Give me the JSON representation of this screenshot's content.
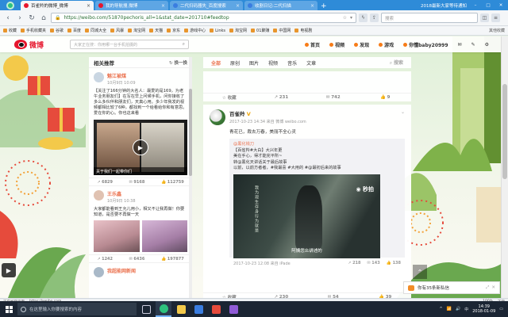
{
  "browser": {
    "tabs": [
      {
        "label": "百雀羚的微博_微博",
        "active": true
      },
      {
        "label": "我的导航搜,微博",
        "active": false
      },
      {
        "label": "二代扫码器失_百度搜索",
        "active": false
      },
      {
        "label": "收割日记:二代扫描",
        "active": false
      }
    ],
    "window_right_text": "2018最新大家等待通知",
    "url": "https://weibo.com/51870pechoris_all=1&stat_date=201710#feedtop",
    "search_placeholder": "搜索",
    "bookmarks": [
      "收藏",
      "手机收藏夹",
      "谷歌",
      "百度",
      "同城大全",
      "风暴",
      "淘宝网",
      "天猫",
      "京东",
      "游戏中心",
      "Links",
      "淘宝网",
      "01聚赚",
      "中国网",
      "电视剧"
    ],
    "bookmarks_right": [
      "其他收藏"
    ]
  },
  "weibo": {
    "logo_text": "微博",
    "search_placeholder": "大家正在搜：你用哪一台手机拍摄的",
    "nav": [
      "首页",
      "视频",
      "发现",
      "游戏",
      "你懂baby20999"
    ],
    "left_card": {
      "title": "相关推荐",
      "refresh": "换一换",
      "post1": {
        "user": "魅江被煤",
        "time": "10月9日 10:09",
        "text": "【关注了166分钟的大名人：最爱的是169，为老午业务朋友们】在写在早上问候手机，问你接收了多么多伙伴和朋友们，天真心用。多少年我发的视频都相比较了6种，都找到一个给看给你和有意思。爱在你的心。你也这来看"
      },
      "video_caption": "关于我们一起带你们",
      "post1_stats": [
        "6829",
        "9168",
        "112759"
      ],
      "post2": {
        "user": "王乐鑫",
        "time": "10月9日 10:38",
        "text": "大家都能看到王允儿用小，相又不让我再做！你要知道，是否要不再做一天"
      },
      "post2_stats": [
        "1242",
        "6436",
        "197877"
      ],
      "post3_user": "我超能网新闻"
    },
    "feed": {
      "tabs": [
        "全部",
        "原创",
        "图片",
        "视频",
        "音乐",
        "文章"
      ],
      "search_label": "搜索",
      "card1_actions": [
        "收藏",
        "231",
        "742",
        "9"
      ],
      "post": {
        "user": "百雀羚",
        "time": "2017-10-23 14:34 来自 微博 weibo.com",
        "text": "青花已，裁去万春，美丽不全心灵",
        "repost_user": "@黑化钱刀",
        "repost_lines": [
          "【百雀羚#大白】大兴年更",
          "美在手心，得才能完平所~",
          "转@黑化天讲话关于最后故事",
          "以前，以前方者者，#我最喜 #大用的 #@最初后来的故事"
        ],
        "video_text": "我为现生存身行为就是",
        "video_logo": "秒拍",
        "video_caption": "阿姨怎么讲述的",
        "repost_time": "2017-10-23 12:08 来自 iPade",
        "repost_stats": [
          "218",
          "143",
          "138"
        ],
        "actions": [
          "收藏",
          "230",
          "54",
          "39"
        ]
      }
    },
    "chat": "你有35条新私信"
  },
  "status": {
    "left": [
      "正在加载页面",
      "https://weibo.com"
    ],
    "right": [
      "100%",
      "下载"
    ]
  },
  "taskbar": {
    "search_placeholder": "在这里输入你要搜索的内容",
    "time": "14:39",
    "date": "2018-01-09",
    "ime": "中",
    "tray": [
      "^",
      "中"
    ]
  }
}
